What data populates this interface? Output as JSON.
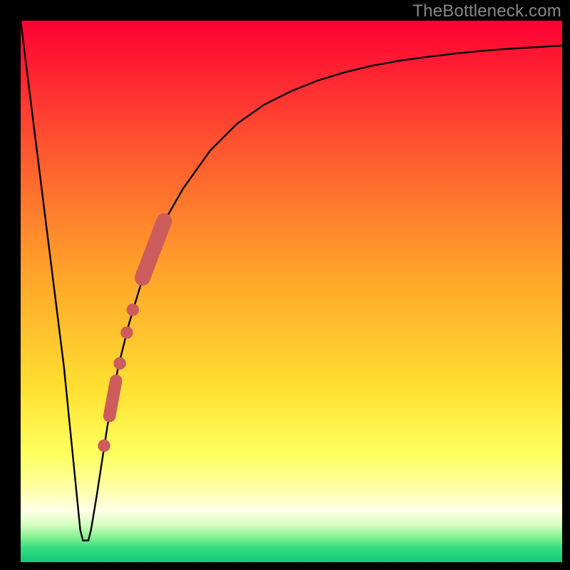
{
  "attribution": "TheBottleneck.com",
  "colors": {
    "frame": "#000000",
    "curve": "#000000",
    "markers": "#cd5c5c",
    "gradient_stops": [
      {
        "offset": 0.0,
        "color": "#ff0033"
      },
      {
        "offset": 0.22,
        "color": "#ff5030"
      },
      {
        "offset": 0.45,
        "color": "#ff9e2a"
      },
      {
        "offset": 0.68,
        "color": "#ffe030"
      },
      {
        "offset": 0.8,
        "color": "#ffff60"
      },
      {
        "offset": 0.86,
        "color": "#ffffa0"
      },
      {
        "offset": 0.905,
        "color": "#ffffe8"
      },
      {
        "offset": 0.93,
        "color": "#d8ffc0"
      },
      {
        "offset": 0.955,
        "color": "#80f090"
      },
      {
        "offset": 0.975,
        "color": "#30dd80"
      },
      {
        "offset": 1.0,
        "color": "#18c878"
      }
    ]
  },
  "chart_data": {
    "type": "line",
    "title": "",
    "xlabel": "",
    "ylabel": "",
    "xlim": [
      0,
      100
    ],
    "ylim": [
      0,
      100
    ],
    "grid": false,
    "legend": false,
    "series": [
      {
        "name": "bottleneck-curve",
        "x": [
          0,
          4,
          8,
          10,
          11,
          11.5,
          12.5,
          13,
          14,
          16,
          18,
          20,
          23,
          26,
          30,
          35,
          40,
          45,
          50,
          55,
          60,
          65,
          70,
          75,
          80,
          85,
          90,
          95,
          100
        ],
        "y": [
          100,
          68,
          36,
          16,
          6,
          4,
          4,
          6,
          12,
          25,
          36,
          44,
          54,
          62,
          69,
          76,
          81,
          84.5,
          87,
          89,
          90.5,
          91.7,
          92.6,
          93.3,
          93.9,
          94.4,
          94.8,
          95.1,
          95.4
        ]
      }
    ],
    "markers": [
      {
        "name": "marker-segment-top",
        "x1": 22.5,
        "y1": 52.5,
        "x2": 26.5,
        "y2": 63.0,
        "r": 1.45
      },
      {
        "name": "marker-dot-1",
        "cx": 20.7,
        "cy": 46.6,
        "r": 1.15
      },
      {
        "name": "marker-dot-2",
        "cx": 19.6,
        "cy": 42.4,
        "r": 1.15
      },
      {
        "name": "marker-dot-3",
        "cx": 18.3,
        "cy": 36.7,
        "r": 1.15
      },
      {
        "name": "marker-segment-bottom",
        "x1": 16.4,
        "y1": 27.0,
        "x2": 17.6,
        "y2": 33.5,
        "r": 1.15
      },
      {
        "name": "marker-dot-4",
        "cx": 15.4,
        "cy": 21.5,
        "r": 1.15
      }
    ]
  }
}
